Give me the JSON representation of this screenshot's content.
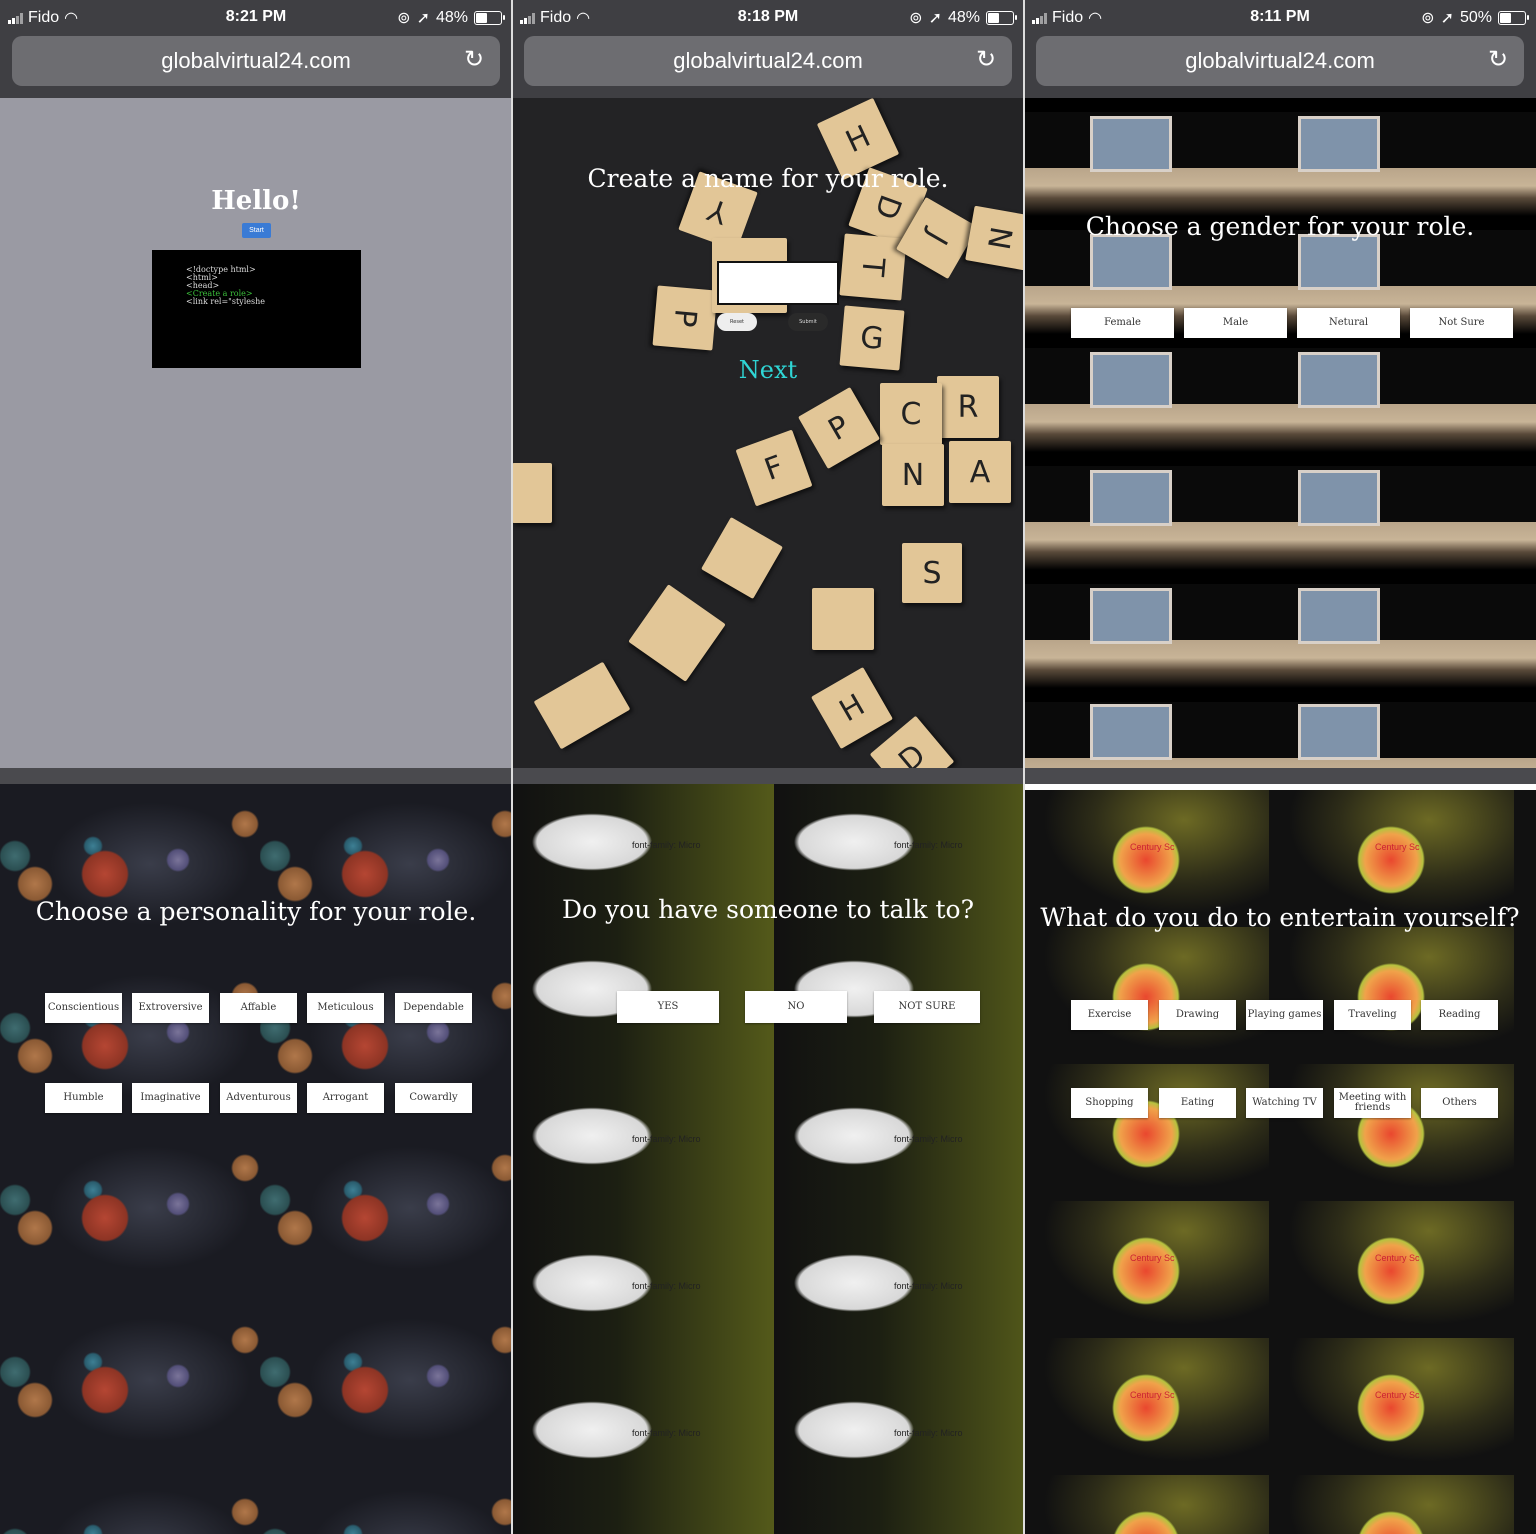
{
  "panels": [
    {
      "status": {
        "carrier": "Fido",
        "time": "8:21 PM",
        "battery": "48%",
        "battery_fill": 0.48
      },
      "url": "globalvirtual24.com",
      "heading": "Hello!",
      "start_label": "Start",
      "code_lines": [
        "<!doctype html>",
        "<html>",
        "<head>",
        "<Create a role>",
        "<link rel=\"styleshe"
      ]
    },
    {
      "status": {
        "carrier": "Fido",
        "time": "8:18 PM",
        "battery": "48%",
        "battery_fill": 0.48
      },
      "url": "globalvirtual24.com",
      "heading": "Create a name for your role.",
      "reset_label": "Reset",
      "submit_label": "Submit",
      "next_label": "Next",
      "tile_letters": [
        "H",
        "Y",
        "D",
        "T",
        "J",
        "N",
        "P",
        "G",
        "R",
        "C",
        "F",
        "P",
        "N",
        "A",
        "S",
        "H",
        "D"
      ]
    },
    {
      "status": {
        "carrier": "Fido",
        "time": "8:11 PM",
        "battery": "50%",
        "battery_fill": 0.5
      },
      "url": "globalvirtual24.com",
      "heading": "Choose a gender for your role.",
      "options": [
        "Female",
        "Male",
        "Netural",
        "Not Sure"
      ]
    },
    {
      "heading": "Choose a personality for your role.",
      "options_row1": [
        "Conscientious",
        "Extroversive",
        "Affable",
        "Meticulous",
        "Dependable"
      ],
      "options_row2": [
        "Humble",
        "Imaginative",
        "Adventurous",
        "Arrogant",
        "Cowardly"
      ]
    },
    {
      "heading": "Do you have someone to talk to?",
      "options": [
        "YES",
        "NO",
        "NOT SURE"
      ],
      "paper_text": "font-family: Micro"
    },
    {
      "heading": "What do you do to entertain yourself?",
      "options_row1": [
        "Exercise",
        "Drawing",
        "Playing games",
        "Traveling",
        "Reading"
      ],
      "options_row2": [
        "Shopping",
        "Eating",
        "Watching TV",
        "Meeting with friends",
        "Others"
      ],
      "apple_text": "Century Sc"
    }
  ],
  "colors": {
    "panel1_bg": "#9a9aa3",
    "next_color": "#2fd5d5",
    "start_btn": "#3a7bd5"
  }
}
